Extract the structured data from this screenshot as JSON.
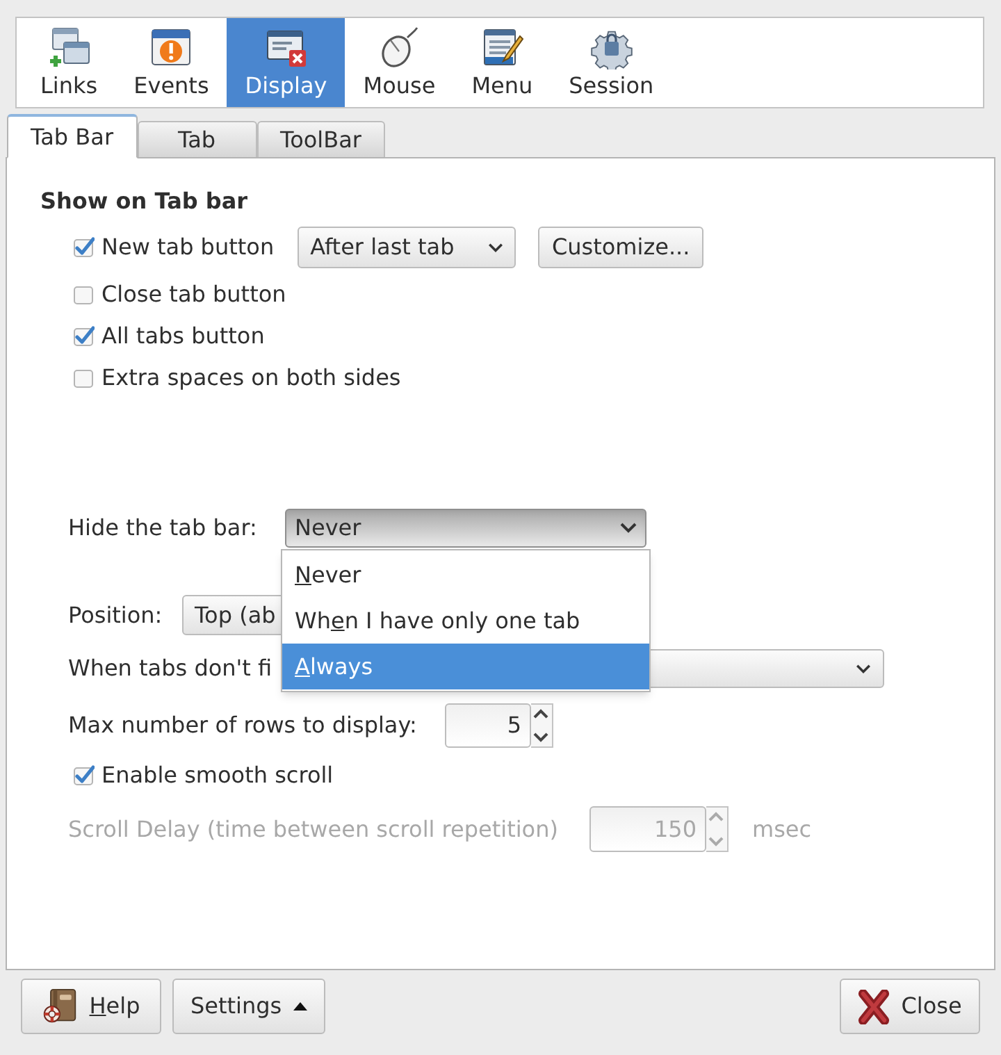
{
  "toolbar": {
    "items": [
      {
        "label": "Links",
        "selected": false
      },
      {
        "label": "Events",
        "selected": false
      },
      {
        "label": "Display",
        "selected": true
      },
      {
        "label": "Mouse",
        "selected": false
      },
      {
        "label": "Menu",
        "selected": false
      },
      {
        "label": "Session",
        "selected": false
      }
    ]
  },
  "tabs": [
    {
      "label": "Tab Bar",
      "selected": true
    },
    {
      "label": "Tab",
      "selected": false
    },
    {
      "label": "ToolBar",
      "selected": false
    }
  ],
  "show_on_tab_bar": {
    "title": "Show on Tab bar",
    "options": [
      {
        "kind": "with_controls",
        "label": "New tab button",
        "checked": true,
        "position_select": "After last tab",
        "customize_button": "Customize..."
      },
      {
        "kind": "plain",
        "label": "Close tab button",
        "checked": false
      },
      {
        "kind": "plain",
        "label": "All tabs button",
        "checked": true
      },
      {
        "kind": "plain",
        "label": "Extra spaces on both sides",
        "checked": false
      }
    ]
  },
  "hide_tab_bar": {
    "label": "Hide the tab bar:",
    "value": "Never",
    "expanded": true,
    "options": [
      {
        "access_key": "N",
        "after": "ever",
        "selected": false
      },
      {
        "before": "Wh",
        "access_key": "e",
        "after": "n I have only one tab",
        "selected": false
      },
      {
        "access_key": "A",
        "after": "lways",
        "selected": true
      }
    ]
  },
  "position": {
    "label": "Position:",
    "value": "Top (ab"
  },
  "overflow": {
    "label": "When tabs don't fi"
  },
  "max_rows": {
    "label": "Max number of rows to display:",
    "value": "5"
  },
  "smooth_scroll": {
    "label": "Enable smooth scroll",
    "checked": true
  },
  "scroll_delay": {
    "label": "Scroll Delay (time between scroll repetition)",
    "value": "150",
    "unit": "msec",
    "disabled": true
  },
  "buttons": [
    {
      "kind": "help",
      "access_key": "H",
      "after": "elp"
    },
    {
      "kind": "menu",
      "label": "Settings"
    },
    {
      "kind": "close",
      "label": "Close"
    }
  ]
}
